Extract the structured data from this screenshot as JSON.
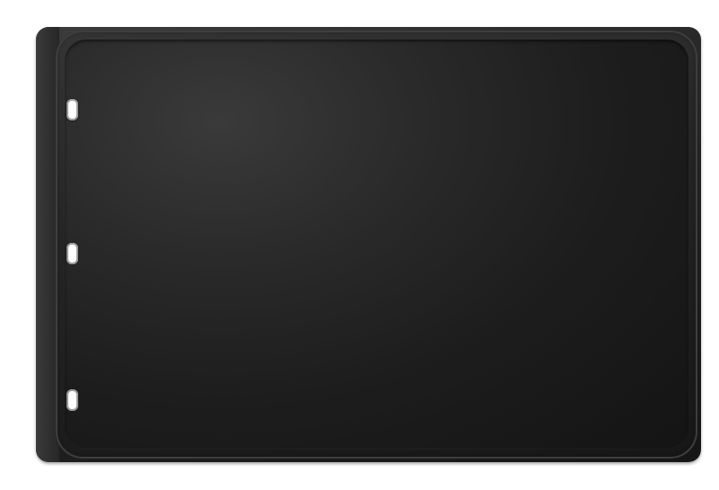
{
  "scene": {
    "subject_icon": "griddle-plate-icon",
    "colors": {
      "background": "#ffffff",
      "plate": "#1e1e1e",
      "rim": "#3a3a3a",
      "slot_hole": "#ffffff"
    },
    "slot_count": 3
  }
}
